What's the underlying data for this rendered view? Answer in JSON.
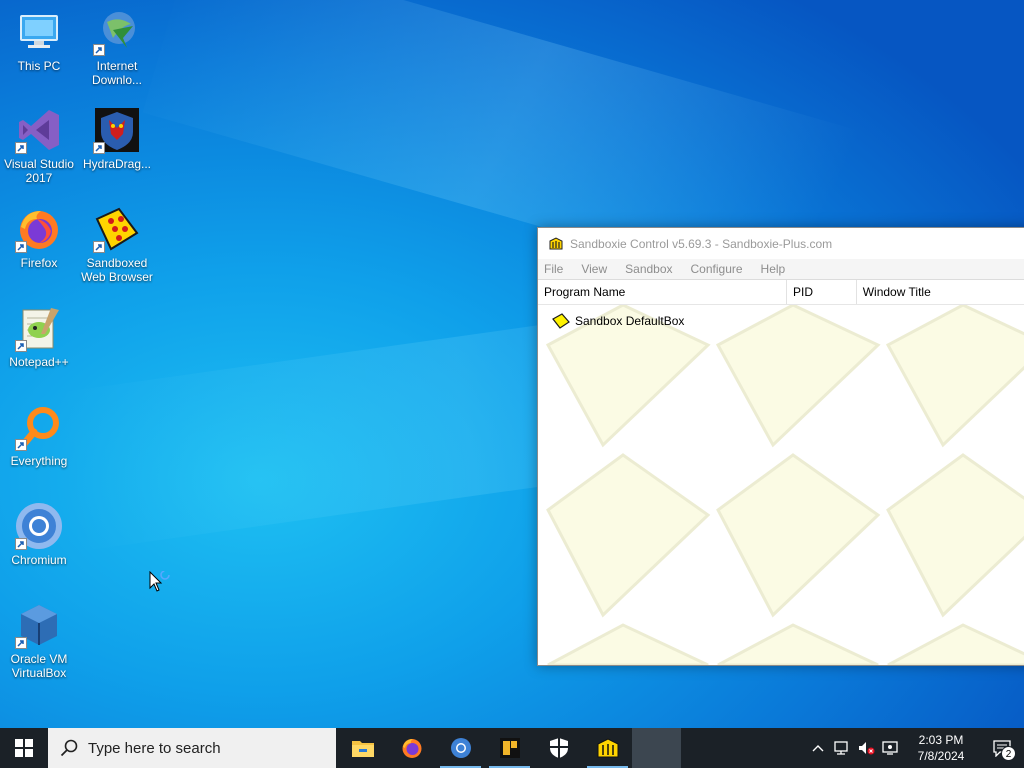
{
  "desktop": {
    "icons": [
      {
        "label": "This PC",
        "icon": "computer-icon"
      },
      {
        "label": "Internet Downlo...",
        "icon": "idm-icon"
      },
      {
        "label": "Visual Studio 2017",
        "icon": "visual-studio-icon"
      },
      {
        "label": "HydraDrag...",
        "icon": "hydradragon-icon"
      },
      {
        "label": "Firefox",
        "icon": "firefox-icon"
      },
      {
        "label": "Sandboxed Web Browser",
        "icon": "sandboxed-browser-icon"
      },
      {
        "label": "Notepad++",
        "icon": "notepadpp-icon"
      },
      {
        "label": "Everything",
        "icon": "everything-icon"
      },
      {
        "label": "Chromium",
        "icon": "chromium-icon"
      },
      {
        "label": "Oracle VM VirtualBox",
        "icon": "virtualbox-icon"
      }
    ]
  },
  "window": {
    "title": "Sandboxie Control v5.69.3 - Sandboxie-Plus.com",
    "menu": [
      "File",
      "View",
      "Sandbox",
      "Configure",
      "Help"
    ],
    "columns": [
      "Program Name",
      "PID",
      "Window Title"
    ],
    "rows": [
      {
        "name": "Sandbox DefaultBox",
        "icon": "sandbox-icon"
      }
    ]
  },
  "taskbar": {
    "search_placeholder": "Type here to search",
    "apps": [
      "file-explorer-icon",
      "firefox-icon",
      "chromium-icon",
      "app-icon",
      "security-shield-icon",
      "sandboxie-icon",
      "blank-app-icon"
    ],
    "clock_time": "2:03 PM",
    "clock_date": "7/8/2024",
    "notification_count": "2"
  },
  "colors": {
    "taskbar": "#1b2127",
    "accent": "#76b9ed",
    "desktop": "#0a79d8"
  }
}
